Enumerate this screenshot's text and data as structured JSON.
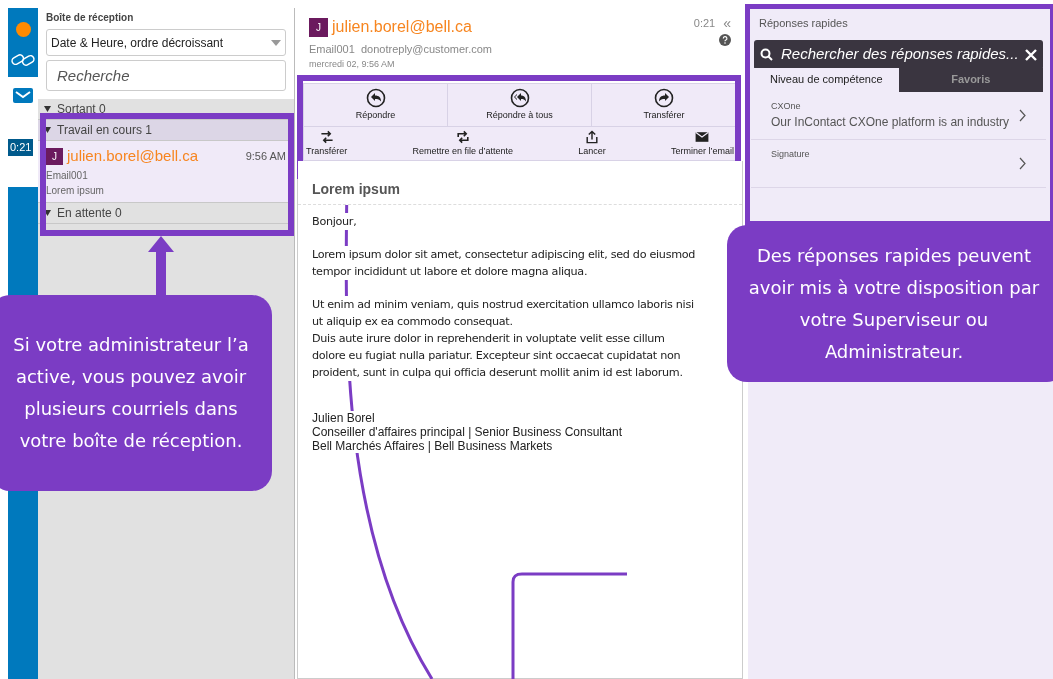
{
  "rail": {
    "timer": "0:21"
  },
  "inbox": {
    "title": "Boîte de réception",
    "sort": "Date & Heure, ordre décroissant",
    "search": {
      "placeholder": "Recherche"
    },
    "groups": [
      {
        "label": "Sortant 0",
        "expanded": true
      },
      {
        "label": "Travail en cours 1",
        "expanded": true,
        "items": [
          {
            "initial": "J",
            "from": "julien.borel@bell.ca",
            "time": "9:56 AM",
            "id_text": "Email001",
            "subject": "Lorem ipsum",
            "selected": true
          }
        ]
      },
      {
        "label": "En attente 0",
        "expanded": true
      }
    ]
  },
  "email": {
    "initial": "J",
    "from": "julien.borel@bell.ca",
    "timer": "0:21",
    "collapse": "«",
    "meta": "Email001  donotreply@customer.com",
    "date": "mercredi 02, 9:56 AM",
    "actions_top": [
      {
        "kind": "reply",
        "label": "Répondre"
      },
      {
        "kind": "reply_all",
        "label": "Répondre à tous"
      },
      {
        "kind": "forward",
        "label": "Transférer"
      }
    ],
    "actions_bottom": [
      {
        "kind": "transfer",
        "label": "Transférer"
      },
      {
        "kind": "requeue",
        "label": "Remettre en file d’attente"
      },
      {
        "kind": "launch",
        "label": "Lancer"
      },
      {
        "kind": "end",
        "label": "Terminer l’email"
      }
    ],
    "subject": "Lorem ipsum",
    "body": [
      [
        "Bonjour,"
      ],
      [
        "Lorem ipsum dolor sit amet, consectetur adipiscing elit, sed do eiusmod",
        "tempor incididunt ut labore et dolore magna aliqua."
      ],
      [
        "Ut enim ad minim veniam, quis nostrud exercitation ullamco laboris nisi",
        "ut aliquip ex ea commodo consequat.",
        "Duis aute irure dolor in reprehenderit in voluptate velit esse cillum",
        "dolore eu fugiat nulla pariatur. Excepteur sint occaecat cupidatat non",
        "proident, sunt in culpa qui officia deserunt mollit anim id est laborum."
      ]
    ],
    "signature": [
      "Julien Borel",
      "Conseiller d'affaires principal | Senior Business Consultant",
      "Bell Marchés Affaires | Bell Business Markets"
    ]
  },
  "quick_replies": {
    "title": "Réponses rapides",
    "search": {
      "placeholder": "Rechercher des réponses rapides..."
    },
    "tabs": [
      {
        "label": "Niveau de compétence",
        "selected": true
      },
      {
        "label": "Favoris",
        "selected": false
      }
    ],
    "items": [
      {
        "category": "CXOne",
        "text": "Our InContact CXOne platform is an industry"
      },
      {
        "category": "Signature"
      }
    ]
  },
  "callouts": [
    {
      "text": "Si votre administrateur l’a active, vous pouvez avoir plusieurs courriels dans votre boîte de réception."
    },
    {
      "text": "Des réponses rapides peuvent avoir mis à votre disposition par votre Superviseur ou Administrateur."
    }
  ]
}
